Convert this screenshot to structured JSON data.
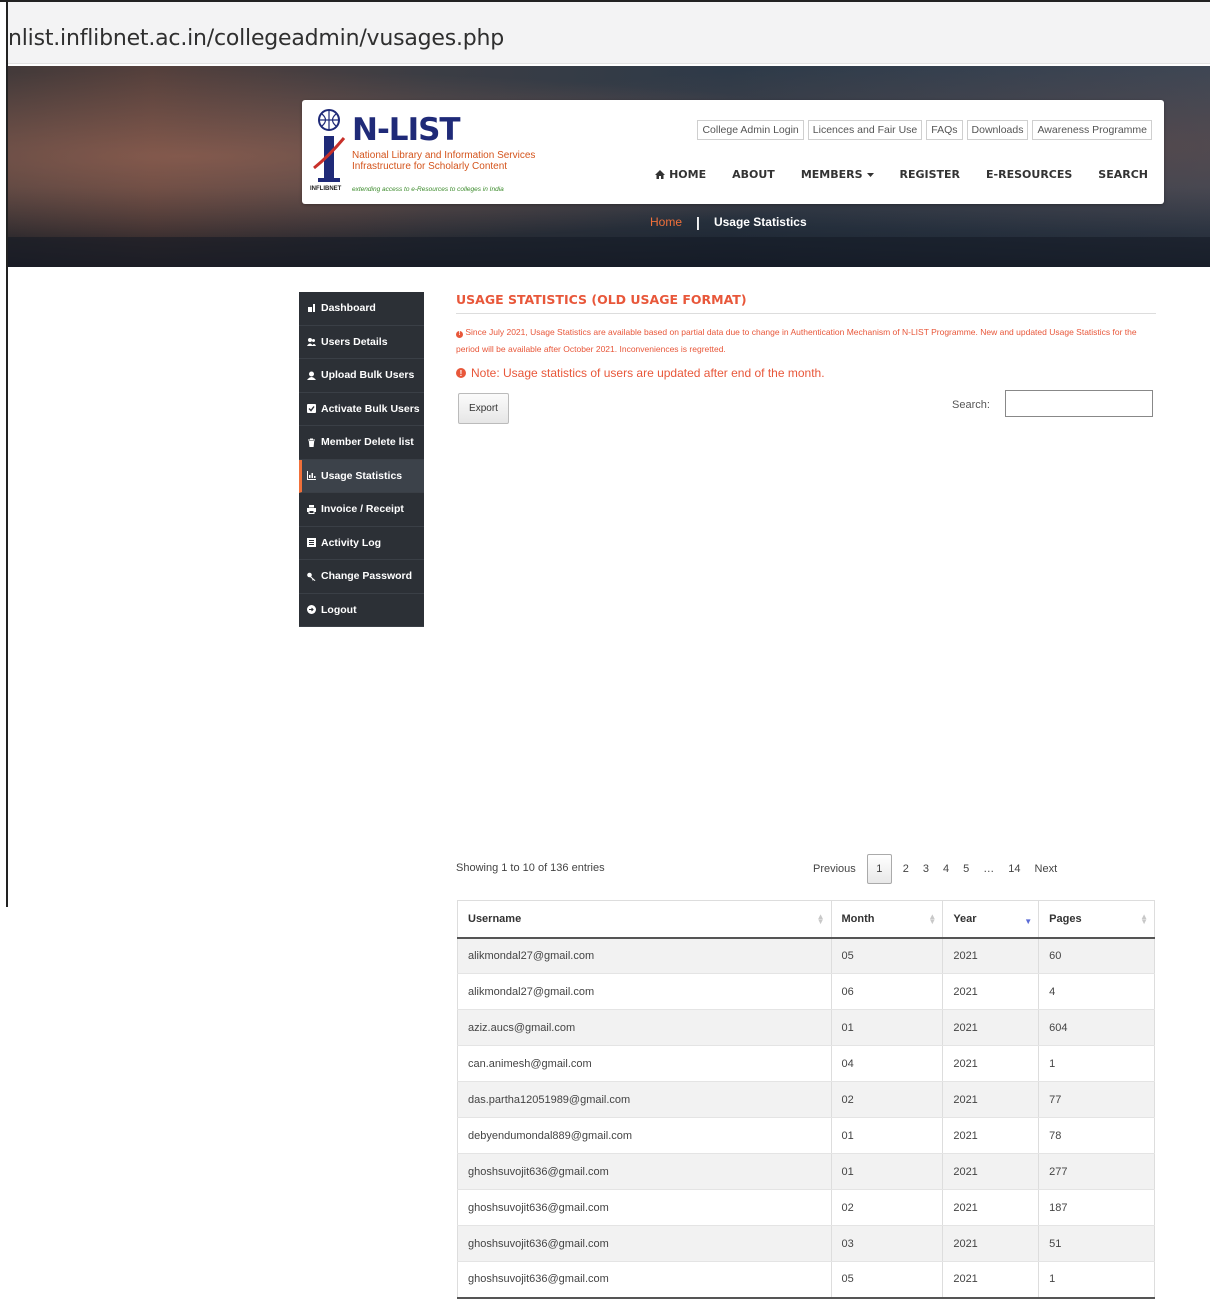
{
  "browser": {
    "url": "nlist.inflibnet.ac.in/collegeadmin/vusages.php"
  },
  "logo": {
    "title": "N-LIST",
    "sub1": "National Library and Information Services",
    "sub2": "Infrastructure for Scholarly Content",
    "tagline": "extending access to e-Resources to colleges in India",
    "org": "INFLIBNET"
  },
  "top_links": [
    "College Admin Login",
    "Licences and Fair Use",
    "FAQs",
    "Downloads",
    "Awareness Programme"
  ],
  "main_nav": {
    "home": "HOME",
    "about": "ABOUT",
    "members": "MEMBERS",
    "register": "REGISTER",
    "eresources": "E-RESOURCES",
    "search": "SEARCH"
  },
  "breadcrumb": {
    "home": "Home",
    "separator": "|",
    "current": "Usage Statistics"
  },
  "sidebar": {
    "items": [
      {
        "label": "Dashboard",
        "icon": "dashboard-icon"
      },
      {
        "label": "Users Details",
        "icon": "users-icon"
      },
      {
        "label": "Upload Bulk Users",
        "icon": "upload-users-icon"
      },
      {
        "label": "Activate Bulk Users",
        "icon": "activate-check-icon"
      },
      {
        "label": "Member Delete list",
        "icon": "trash-icon"
      },
      {
        "label": "Usage Statistics",
        "icon": "bar-chart-icon"
      },
      {
        "label": "Invoice / Receipt",
        "icon": "print-icon"
      },
      {
        "label": "Activity Log",
        "icon": "list-icon"
      },
      {
        "label": "Change Password",
        "icon": "key-icon"
      },
      {
        "label": "Logout",
        "icon": "logout-icon"
      }
    ],
    "active_index": 5
  },
  "content": {
    "title": "USAGE STATISTICS (OLD USAGE FORMAT)",
    "notice": "Since July 2021, Usage Statistics are available based on partial data due to change in Authentication Mechanism of N-LIST Programme. New and updated Usage Statistics for the period will be available after October 2021. Inconveniences is regretted.",
    "note": "Note: Usage statistics of users are updated after end of the month.",
    "export_label": "Export",
    "search_label": "Search:",
    "search_value": ""
  },
  "table": {
    "headers": [
      "Username",
      "Month",
      "Year",
      "Pages"
    ],
    "rows": [
      [
        "alikmondal27@gmail.com",
        "05",
        "2021",
        "60"
      ],
      [
        "alikmondal27@gmail.com",
        "06",
        "2021",
        "4"
      ],
      [
        "aziz.aucs@gmail.com",
        "01",
        "2021",
        "604"
      ],
      [
        "can.animesh@gmail.com",
        "04",
        "2021",
        "1"
      ],
      [
        "das.partha12051989@gmail.com",
        "02",
        "2021",
        "77"
      ],
      [
        "debyendumondal889@gmail.com",
        "01",
        "2021",
        "78"
      ],
      [
        "ghoshsuvojit636@gmail.com",
        "01",
        "2021",
        "277"
      ],
      [
        "ghoshsuvojit636@gmail.com",
        "02",
        "2021",
        "187"
      ],
      [
        "ghoshsuvojit636@gmail.com",
        "03",
        "2021",
        "51"
      ],
      [
        "ghoshsuvojit636@gmail.com",
        "05",
        "2021",
        "1"
      ]
    ]
  },
  "pagination": {
    "info": "Showing 1 to 10 of 136 entries",
    "previous": "Previous",
    "pages": [
      "1",
      "2",
      "3",
      "4",
      "5",
      "…",
      "14"
    ],
    "current": "1",
    "next": "Next"
  },
  "colors": {
    "accent": "#e8573a",
    "sidebar_bg": "#2c3036",
    "brand_blue": "#1f2a78",
    "sort_active": "#5b6bd6"
  }
}
